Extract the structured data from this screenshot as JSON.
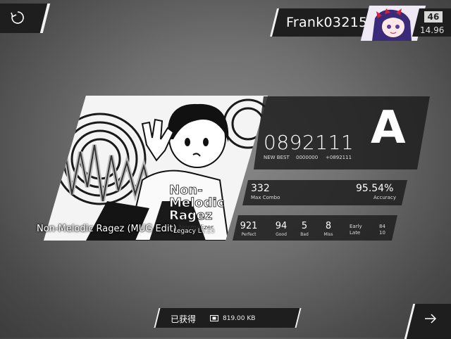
{
  "player": {
    "name": "Frank03215",
    "level": "46",
    "rks": "14.96"
  },
  "song": {
    "name": "Non-Melodic Ragez (MUG Edit)",
    "difficulty": "Legacy  Lv.15",
    "cover_text_line1": "Non-",
    "cover_text_line2": "Melodic",
    "cover_text_line3": "Ragez",
    "cover_text_line4": "Normalizer"
  },
  "result": {
    "score": "0892111",
    "grade": "A",
    "new_best_label": "NEW BEST",
    "previous_best": "0000000",
    "best_diff": "+0892111",
    "max_combo": "332",
    "max_combo_label": "Max Combo",
    "accuracy": "95.54%",
    "accuracy_label": "Accuracy",
    "perfect": "921",
    "perfect_label": "Perfect",
    "good": "94",
    "good_label": "Good",
    "bad": "5",
    "bad_label": "Bad",
    "miss": "8",
    "miss_label": "Miss",
    "early_label": "Early",
    "late_label": "Late",
    "early": "84",
    "late": "10"
  },
  "bottom": {
    "obtained_label": "已获得",
    "data_size": "819.00 KB"
  },
  "icons": {
    "retry": "retry-icon",
    "next": "arrow-right-icon",
    "data": "data-chip-icon"
  }
}
